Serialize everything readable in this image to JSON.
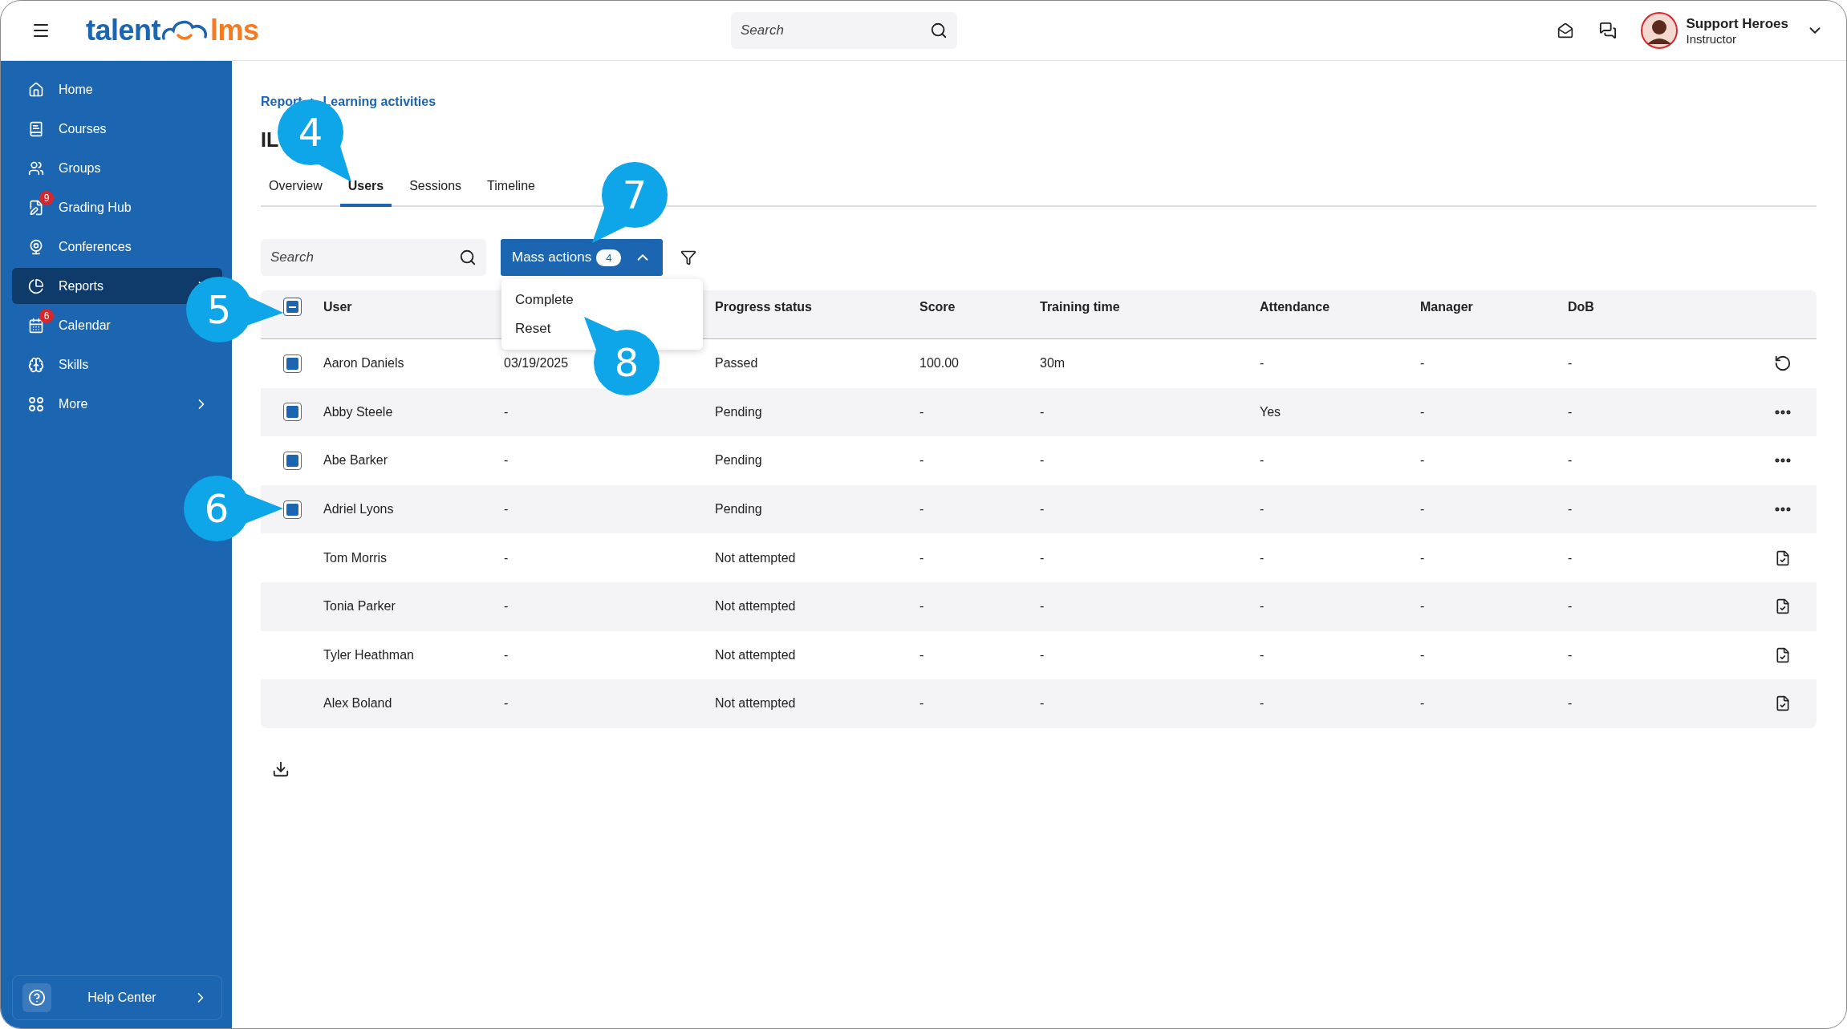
{
  "topbar": {
    "logo": {
      "left": "talent",
      "right": "lms"
    },
    "search": {
      "placeholder": "Search"
    },
    "user": {
      "name": "Support Heroes",
      "role": "Instructor"
    }
  },
  "sidebar": {
    "items": [
      {
        "label": "Home",
        "selected": false,
        "submenu": false
      },
      {
        "label": "Courses",
        "selected": false,
        "submenu": false
      },
      {
        "label": "Groups",
        "selected": false,
        "submenu": false
      },
      {
        "label": "Grading Hub",
        "badge": "9",
        "selected": false,
        "submenu": false
      },
      {
        "label": "Conferences",
        "selected": false,
        "submenu": false
      },
      {
        "label": "Reports",
        "selected": true,
        "submenu": true
      },
      {
        "label": "Calendar",
        "badge": "6",
        "selected": false,
        "submenu": false
      },
      {
        "label": "Skills",
        "selected": false,
        "submenu": false
      },
      {
        "label": "More",
        "selected": false,
        "submenu": true
      }
    ],
    "help": {
      "label": "Help Center"
    }
  },
  "breadcrumb": [
    "Report",
    "Learning activities"
  ],
  "title": "IL",
  "tabs": [
    {
      "label": "Overview",
      "selected": false
    },
    {
      "label": "Users",
      "selected": true
    },
    {
      "label": "Sessions",
      "selected": false
    },
    {
      "label": "Timeline",
      "selected": false
    }
  ],
  "toolbar": {
    "search": {
      "placeholder": "Search"
    },
    "mass_actions": {
      "label": "Mass actions",
      "count": "4",
      "expanded": true,
      "menu": [
        "Complete",
        "Reset"
      ]
    }
  },
  "table": {
    "header_checkbox": {
      "checked": true,
      "partial": true
    },
    "columns": [
      "User",
      "",
      "Progress status",
      "Score",
      "Training time",
      "Attendance",
      "Manager",
      "DoB"
    ],
    "rows": [
      {
        "selectable": true,
        "selected": true,
        "kind": "reset",
        "cells": [
          "Aaron Daniels",
          "03/19/2025",
          "Passed",
          "100.00",
          "30m",
          "-",
          "-",
          "-"
        ]
      },
      {
        "selectable": true,
        "selected": true,
        "kind": "more",
        "cells": [
          "Abby Steele",
          "-",
          "Pending",
          "-",
          "-",
          "Yes",
          "-",
          "-"
        ]
      },
      {
        "selectable": true,
        "selected": true,
        "kind": "more",
        "cells": [
          "Abe Barker",
          "-",
          "Pending",
          "-",
          "-",
          "-",
          "-",
          "-"
        ]
      },
      {
        "selectable": true,
        "selected": true,
        "kind": "more",
        "cells": [
          "Adriel Lyons",
          "-",
          "Pending",
          "-",
          "-",
          "-",
          "-",
          "-"
        ]
      },
      {
        "selectable": false,
        "kind": "complete",
        "cells": [
          "Tom Morris",
          "-",
          "Not attempted",
          "-",
          "-",
          "-",
          "-",
          "-"
        ]
      },
      {
        "selectable": false,
        "kind": "complete",
        "cells": [
          "Tonia Parker",
          "-",
          "Not attempted",
          "-",
          "-",
          "-",
          "-",
          "-"
        ]
      },
      {
        "selectable": false,
        "kind": "complete",
        "cells": [
          "Tyler Heathman",
          "-",
          "Not attempted",
          "-",
          "-",
          "-",
          "-",
          "-"
        ]
      },
      {
        "selectable": false,
        "kind": "complete",
        "cells": [
          "Alex Boland",
          "-",
          "Not attempted",
          "-",
          "-",
          "-",
          "-",
          "-"
        ]
      }
    ]
  },
  "callouts": [
    "4",
    "5",
    "6",
    "7",
    "8"
  ]
}
